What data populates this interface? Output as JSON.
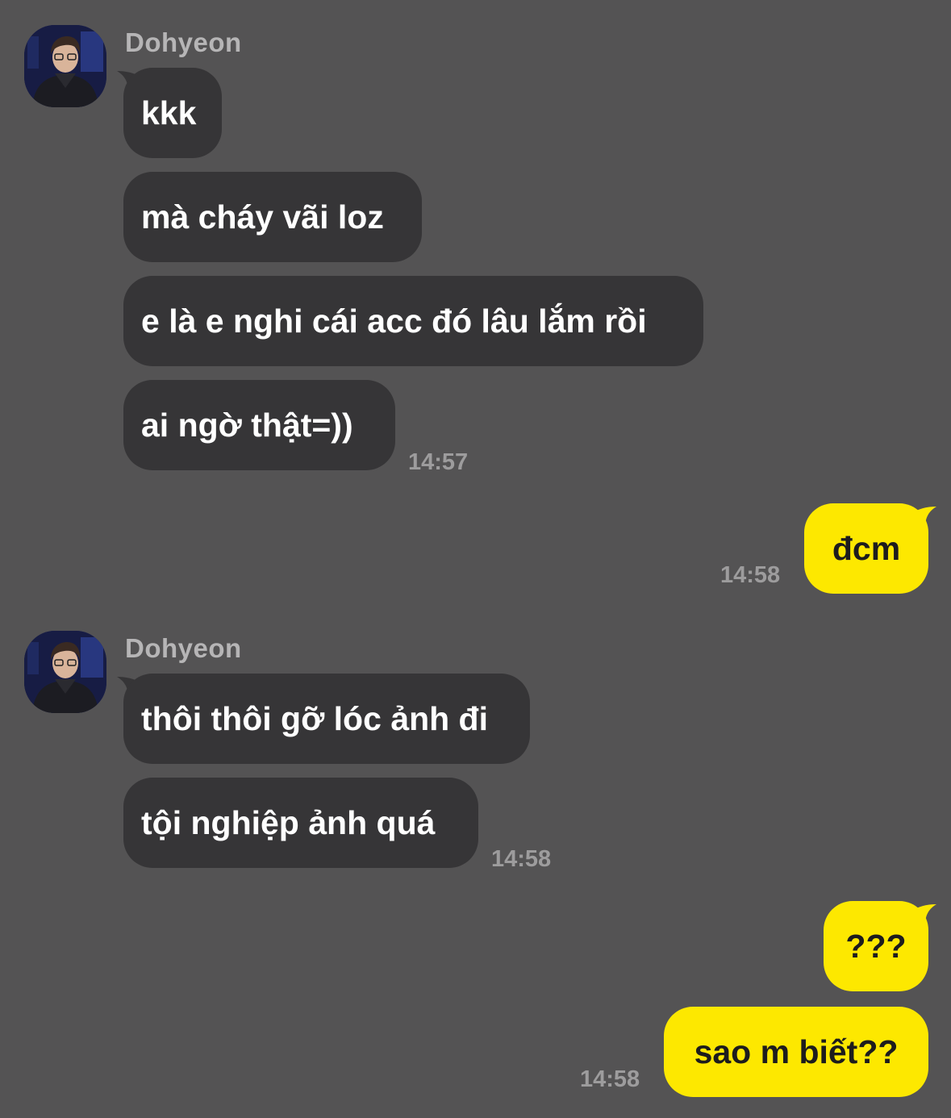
{
  "colors": {
    "background": "#545354",
    "incoming_bubble": "#363537",
    "outgoing_bubble": "#fde800",
    "incoming_text": "#ffffff",
    "outgoing_text": "#1d1c1d",
    "name_text": "#b6b5b6",
    "time_text": "#9d9c9d"
  },
  "conversation": {
    "group1": {
      "sender": "Dohyeon",
      "avatar_icon": "profile-photo",
      "messages": [
        "kkk",
        "mà cháy vãi loz",
        "e là e nghi cái acc đó lâu lắm rồi",
        "ai ngờ thật=))"
      ],
      "time": "14:57"
    },
    "group2": {
      "messages": [
        "đcm"
      ],
      "time": "14:58"
    },
    "group3": {
      "sender": "Dohyeon",
      "avatar_icon": "profile-photo",
      "messages": [
        "thôi thôi gỡ lóc ảnh đi",
        "tội nghiệp ảnh quá"
      ],
      "time": "14:58"
    },
    "group4": {
      "messages": [
        "???",
        "sao m biết??"
      ],
      "time": "14:58"
    }
  }
}
